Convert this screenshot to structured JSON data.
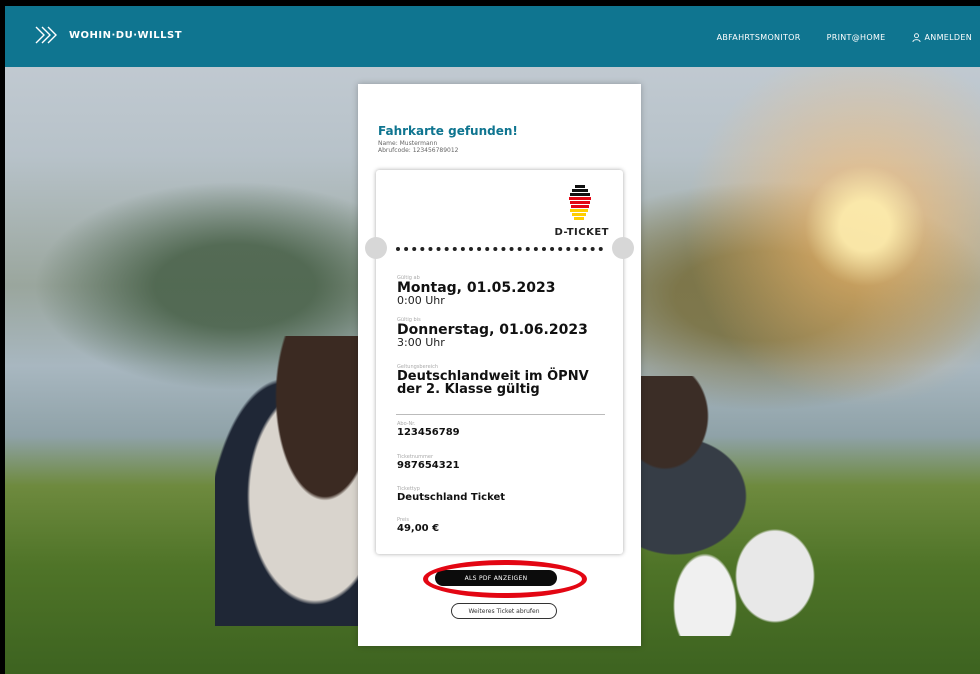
{
  "nav": {
    "logo_text": "WOHIN·DU·WILLST",
    "links": [
      "ABFAHRTSMONITOR",
      "PRINT@HOME",
      "ANMELDEN"
    ]
  },
  "card": {
    "title": "Fahrkarte gefunden!",
    "name_line": "Name: Mustermann",
    "code_line": "Abrufcode: 123456789012",
    "ticket": {
      "badge": "D-TICKET",
      "valid_from_label": "Gültig ab",
      "valid_from_date": "Montag, 01.05.2023",
      "valid_from_time": "0:00 Uhr",
      "valid_to_label": "Gültig bis",
      "valid_to_date": "Donnerstag, 01.06.2023",
      "valid_to_time": "3:00 Uhr",
      "scope_label": "Geltungsbereich",
      "scope_value": "Deutschlandweit im ÖPNV der 2. Klasse gültig",
      "abo_label": "Abo-Nr.",
      "abo_value": "123456789",
      "ticket_no_label": "Ticketnummer",
      "ticket_no_value": "987654321",
      "type_label": "Tickettyp",
      "type_value": "Deutschland Ticket",
      "price_label": "Preis",
      "price_value": "49,00 €"
    },
    "pdf_button": "ALS PDF ANZEIGEN",
    "another_button": "Weiteres Ticket abrufen"
  },
  "colors": {
    "nav_bg": "#0f7590",
    "accent": "#0f7590",
    "highlight": "#e30613"
  }
}
